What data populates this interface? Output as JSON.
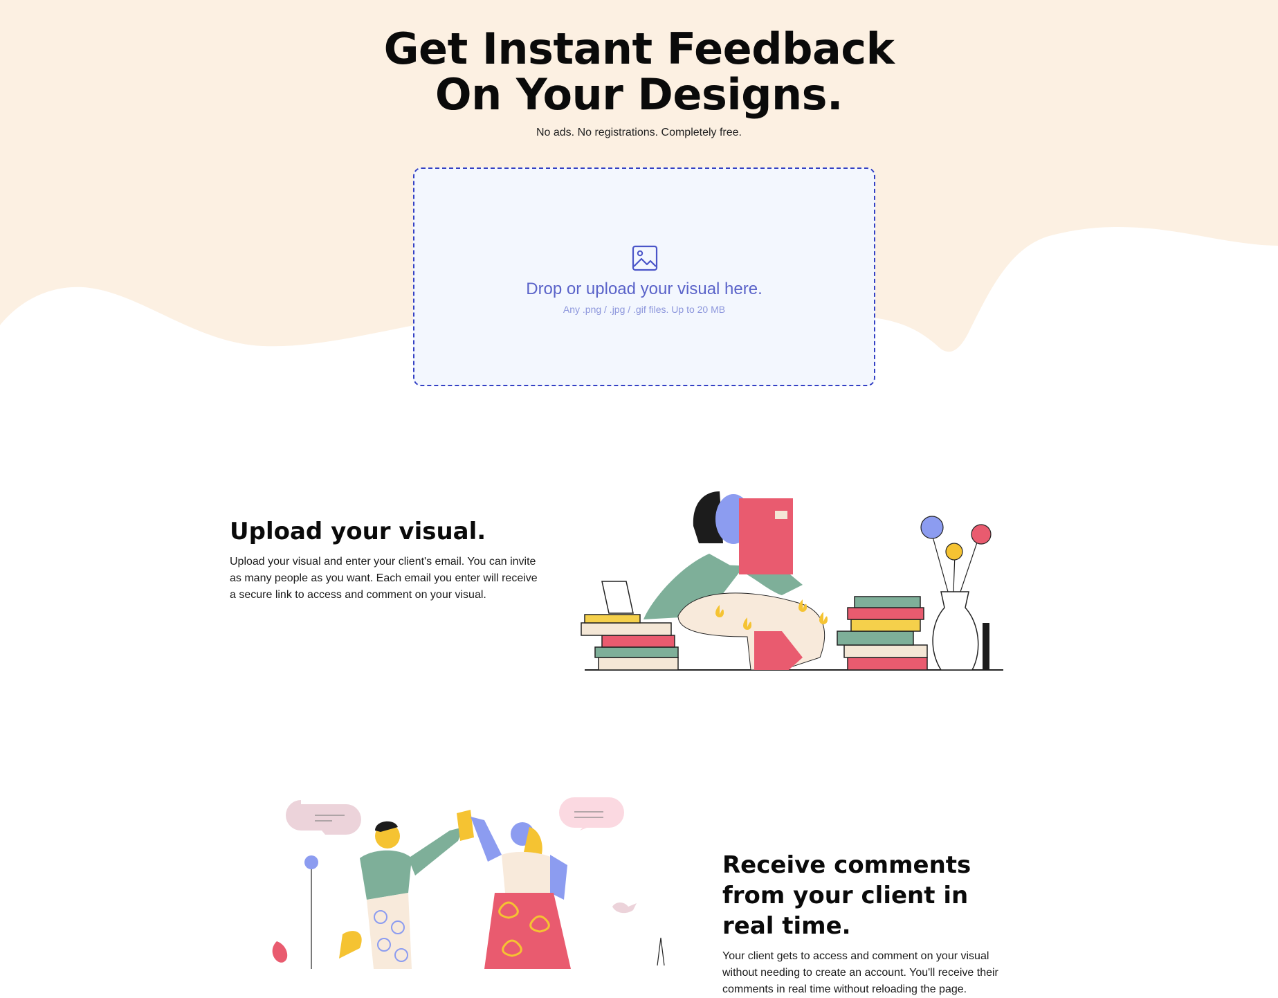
{
  "hero": {
    "title_line1": "Get Instant Feedback",
    "title_line2": "On Your Designs.",
    "subtitle": "No ads. No registrations. Completely free."
  },
  "dropzone": {
    "icon": "image-icon",
    "title": "Drop or upload your visual here.",
    "hint": "Any .png / .jpg / .gif files. Up to 20 MB"
  },
  "features": [
    {
      "title": "Upload your visual.",
      "body": "Upload your visual and enter your client's email. You can invite as many people as you want. Each email you enter will receive a secure link to access and comment on your visual.",
      "illustration": "woman-reading-illustration"
    },
    {
      "title": "Receive comments from your client in real time.",
      "body": "Your client gets to access and comment on your visual without needing to create an account. You'll receive their comments in real time without reloading the page.",
      "illustration": "high-five-illustration"
    }
  ],
  "colors": {
    "hero_background": "#fcf0e2",
    "dropzone_border": "#3340c4",
    "dropzone_background": "#f3f7fe",
    "dropzone_text": "#5a63c9"
  }
}
